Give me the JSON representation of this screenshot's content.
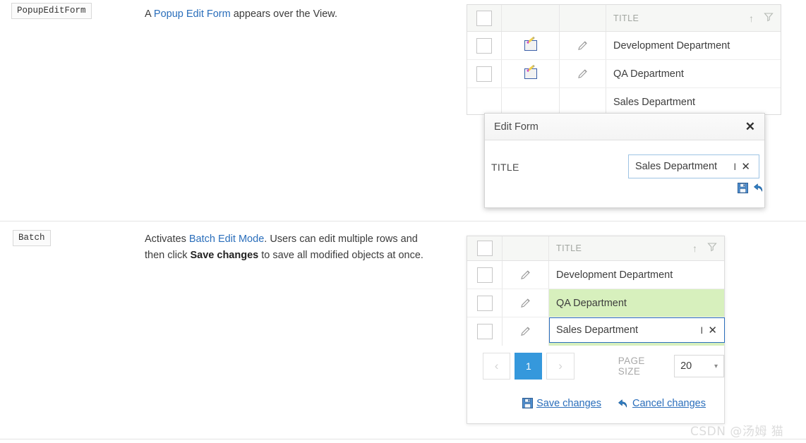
{
  "colors": {
    "accent_blue": "#3598dc",
    "link_blue": "#2a6ebb",
    "row_highlight_green": "#d7f0bd",
    "header_bg": "#f6f7f5",
    "border_gray": "#dcdcdc"
  },
  "sections": [
    {
      "chip": "PopupEditForm",
      "description": {
        "prefix": "A ",
        "link": "Popup Edit Form",
        "suffix": " appears over the View."
      }
    },
    {
      "chip": "Batch",
      "description": {
        "prefix": "Activates ",
        "link": "Batch Edit Mode",
        "mid": ". Users can edit multiple rows and then click ",
        "bold": "Save changes",
        "suffix": " to save all modified objects at once."
      }
    }
  ],
  "grid_top": {
    "header": {
      "select_all_checkbox": "",
      "col_edit_icon": "",
      "col_pencil_icon": "",
      "title": "TITLE",
      "sort_icon": "↑",
      "filter_icon": "filter-icon"
    },
    "rows": [
      {
        "title": "Development Department",
        "edit_icon": "edit-note-icon",
        "pencil_icon": "pencil-icon"
      },
      {
        "title": "QA Department",
        "edit_icon": "edit-note-icon",
        "pencil_icon": "pencil-icon"
      },
      {
        "title": "Sales Department",
        "edit_icon": "",
        "pencil_icon": ""
      }
    ]
  },
  "popup": {
    "title": "Edit Form",
    "close_label": "✕",
    "field_label": "TITLE",
    "field_value": "Sales Department",
    "field_clear": "✕",
    "save_icon": "save-floppy-icon",
    "undo_icon": "undo-arrow-icon"
  },
  "grid_bottom": {
    "header": {
      "select_all_checkbox": "",
      "col_pencil_icon": "",
      "title": "TITLE",
      "sort_icon": "↑",
      "filter_icon": "filter-icon"
    },
    "rows": [
      {
        "title": "Development Department",
        "state": "normal"
      },
      {
        "title": "QA Department",
        "state": "modified"
      },
      {
        "title": "Sales Department",
        "state": "editing"
      }
    ],
    "editor": {
      "value": "Sales Department",
      "clear": "✕"
    },
    "pager": {
      "prev": "‹",
      "pages": [
        "1"
      ],
      "next": "›",
      "page_size_label": "PAGE SIZE",
      "page_size_value": "20",
      "page_size_arrow": "▾"
    },
    "actions": {
      "save_label": "Save changes",
      "cancel_label": "Cancel changes",
      "save_icon": "save-floppy-icon",
      "cancel_icon": "undo-arrow-icon"
    }
  },
  "watermark": "CSDN @汤姆 猫"
}
